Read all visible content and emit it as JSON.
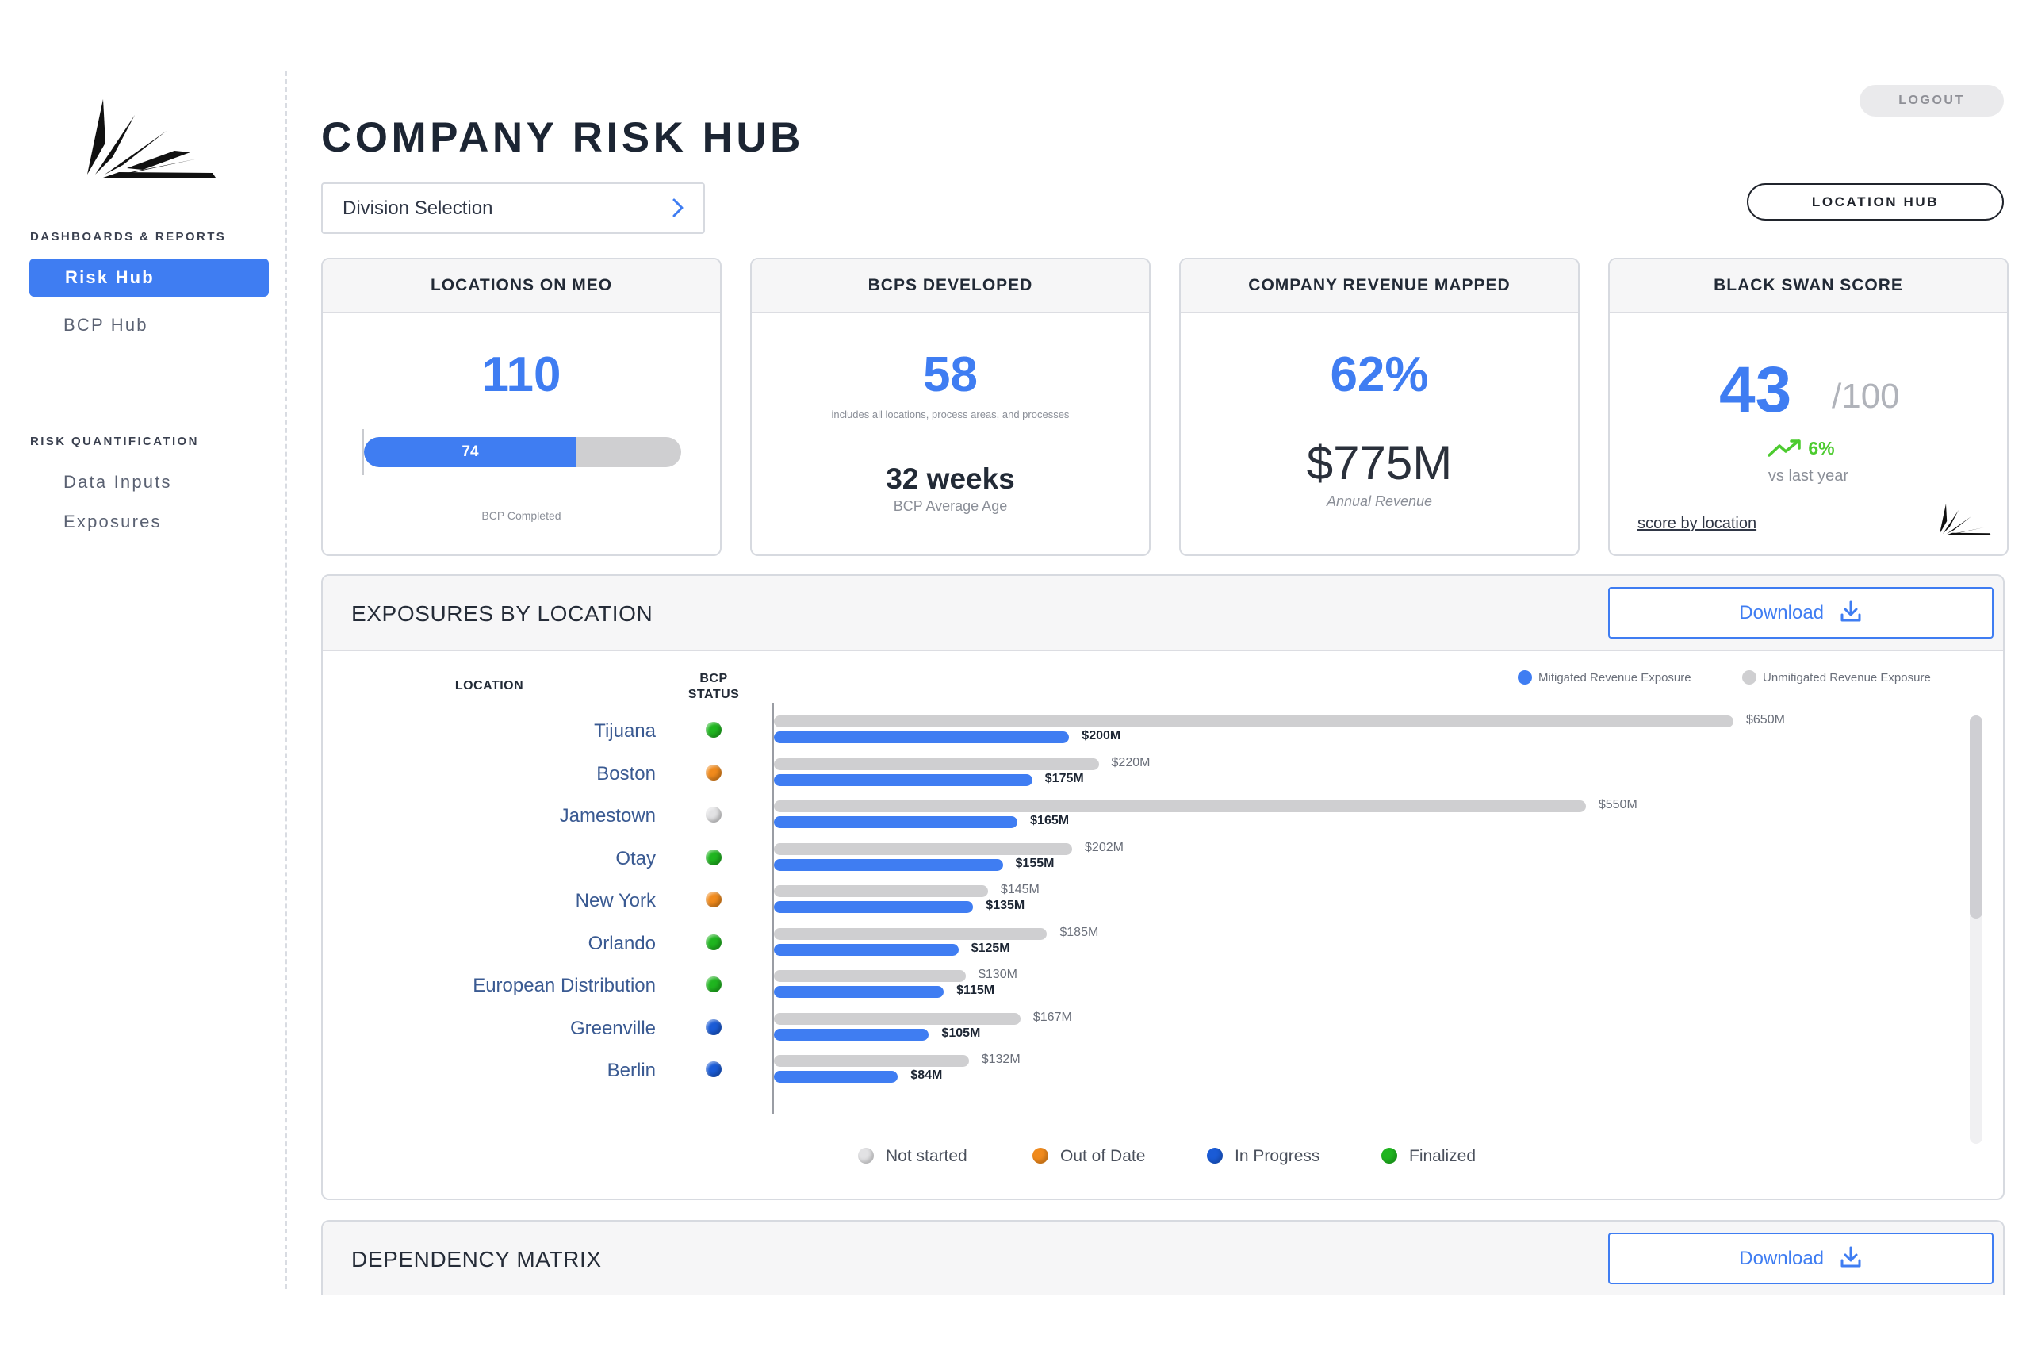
{
  "app": {
    "title": "COMPANY RISK HUB",
    "logout_label": "LOGOUT",
    "division_selection": "Division Selection",
    "location_hub_label": "LOCATION HUB",
    "accent_color": "#3f7df2"
  },
  "sidebar": {
    "section1_title": "DASHBOARDS & REPORTS",
    "section2_title": "RISK QUANTIFICATION",
    "items": [
      {
        "label": "Risk Hub",
        "active": true
      },
      {
        "label": "BCP Hub",
        "active": false
      },
      {
        "label": "Data Inputs",
        "active": false
      },
      {
        "label": "Exposures",
        "active": false
      }
    ]
  },
  "kpis": {
    "locations": {
      "title": "LOCATIONS ON MEO",
      "value": "110",
      "progress_value": "74",
      "progress_fraction": 0.67,
      "progress_caption": "BCP Completed"
    },
    "bcps": {
      "title": "BCPS DEVELOPED",
      "value": "58",
      "note": "includes all locations, process areas, and processes",
      "weeks": "32 weeks",
      "weeks_caption": "BCP Average Age"
    },
    "revenue": {
      "title": "COMPANY REVENUE MAPPED",
      "percent": "62%",
      "amount": "$775M",
      "caption": "Annual Revenue"
    },
    "black_swan": {
      "title": "BLACK SWAN SCORE",
      "score": "43",
      "max": "/100",
      "delta": "6%",
      "vs": "vs last year",
      "link": "score by location"
    }
  },
  "exposures": {
    "title": "EXPOSURES BY LOCATION",
    "download_label": "Download",
    "col_location": "LOCATION",
    "col_bcp_status": "BCP STATUS",
    "legend_mitigated": "Mitigated Revenue Exposure",
    "legend_unmitigated": "Unmitigated Revenue Exposure",
    "status_legend": [
      {
        "label": "Not started",
        "color": "#e2e2e4"
      },
      {
        "label": "Out of Date",
        "color": "#f08a1c"
      },
      {
        "label": "In Progress",
        "color": "#1a5bd6"
      },
      {
        "label": "Finalized",
        "color": "#1fb51f"
      }
    ]
  },
  "chart_data": {
    "type": "bar",
    "orientation": "horizontal",
    "categories": [
      "Tijuana",
      "Boston",
      "Jamestown",
      "Otay",
      "New York",
      "Orlando",
      "European Distribution",
      "Greenville",
      "Berlin"
    ],
    "bcp_status": [
      "Finalized",
      "Out of Date",
      "Not started",
      "Finalized",
      "Out of Date",
      "Finalized",
      "Finalized",
      "In Progress",
      "In Progress"
    ],
    "series": [
      {
        "name": "Unmitigated Revenue Exposure",
        "color": "#cfcfd1",
        "values": [
          650,
          220,
          550,
          202,
          145,
          185,
          130,
          167,
          132
        ],
        "labels": [
          "$650M",
          "$220M",
          "$550M",
          "$202M",
          "$145M",
          "$185M",
          "$130M",
          "$167M",
          "$132M"
        ]
      },
      {
        "name": "Mitigated Revenue Exposure",
        "color": "#3f7df2",
        "values": [
          200,
          175,
          165,
          155,
          135,
          125,
          115,
          105,
          84
        ],
        "labels": [
          "$200M",
          "$175M",
          "$165M",
          "$155M",
          "$135M",
          "$125M",
          "$115M",
          "$105M",
          "$84M"
        ]
      }
    ],
    "xlim": [
      0,
      700
    ],
    "legend_position": "top-right"
  },
  "dependency": {
    "title": "DEPENDENCY MATRIX",
    "download_label": "Download"
  }
}
